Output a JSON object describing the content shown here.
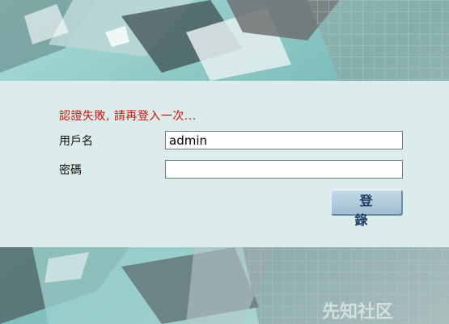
{
  "login": {
    "error_message": "認證失敗, 請再登入一次...",
    "username_label": "用戶名",
    "username_value": "admin",
    "password_label": "密碼",
    "password_value": "",
    "login_button": "登 錄"
  },
  "watermark": "先知社区",
  "colors": {
    "error": "#d01010",
    "panel": "#dcecea",
    "background_teal": "#8fc7c5",
    "button": "#b3cee0"
  }
}
